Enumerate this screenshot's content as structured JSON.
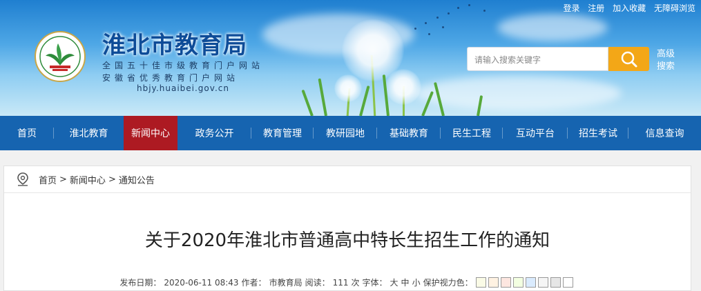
{
  "header": {
    "site_title": "淮北市教育局",
    "subtitle_1": "全国五十佳市级教育门户网站",
    "subtitle_2": "安徽省优秀教育门户网站",
    "domain": "hbjy.huaibei.gov.cn",
    "top_links": [
      "登录",
      "注册",
      "加入收藏",
      "无障碍浏览"
    ],
    "search": {
      "placeholder": "请输入搜索关键字",
      "advanced_label": "高级搜索"
    }
  },
  "nav": {
    "items": [
      {
        "label": "首页"
      },
      {
        "label": "淮北教育"
      },
      {
        "label": "新闻中心",
        "active": true
      },
      {
        "label": "政务公开"
      },
      {
        "label": "教育管理"
      },
      {
        "label": "教研园地"
      },
      {
        "label": "基础教育"
      },
      {
        "label": "民生工程"
      },
      {
        "label": "互动平台"
      },
      {
        "label": "招生考试"
      },
      {
        "label": "信息查询"
      }
    ]
  },
  "breadcrumb": {
    "items": [
      "首页",
      "新闻中心",
      "通知公告"
    ],
    "separator": ">"
  },
  "article": {
    "title": "关于2020年淮北市普通高中特长生招生工作的通知",
    "meta": {
      "date_label": "发布日期：",
      "date": "2020-06-11 08:43",
      "author_label": "作者：",
      "author": "市教育局",
      "reads_label": "阅读：",
      "reads": "111",
      "reads_unit": "次",
      "font_label": "字体：",
      "font_sizes": [
        "大",
        "中",
        "小"
      ],
      "eye_label": "保护视力色：",
      "eye_colors": [
        "#fafbe6",
        "#fff2e2",
        "#fde6e0",
        "#f3ffe1",
        "#daebfe",
        "#f5f5f5",
        "#e6e6e6",
        "#ffffff"
      ]
    }
  },
  "colors": {
    "nav_bg": "#1664b0",
    "nav_active": "#ad1a22",
    "search_button": "#f3a717",
    "title_blue": "#0e4c98"
  }
}
